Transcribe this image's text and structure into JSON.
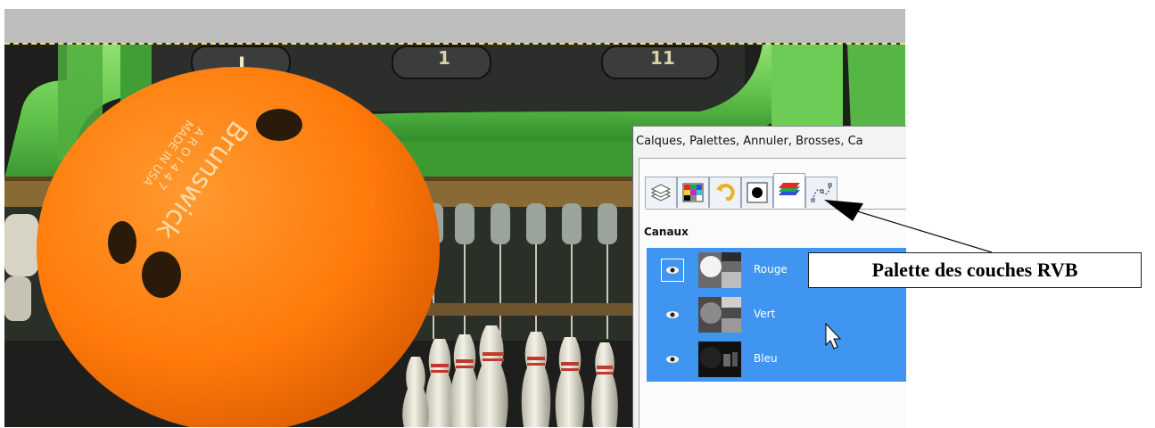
{
  "panel": {
    "title": "Calques, Palettes, Annuler, Brosses, Ca",
    "section_label": "Canaux",
    "tabs": [
      {
        "icon": "layers-icon"
      },
      {
        "icon": "palette-icon"
      },
      {
        "icon": "undo-history-icon"
      },
      {
        "icon": "brushes-icon"
      },
      {
        "icon": "channels-icon",
        "active": true
      },
      {
        "icon": "paths-icon"
      }
    ],
    "channels": [
      {
        "label": "Rouge",
        "visible": true
      },
      {
        "label": "Vert",
        "visible": true
      },
      {
        "label": "Bleu",
        "visible": true
      }
    ]
  },
  "callout": {
    "text": "Palette des couches RVB"
  },
  "photo": {
    "ball_text_brand": "Brunswick",
    "ball_text_made": "MADE IN USA",
    "ball_text_code": "A R O I 4 4 7",
    "slot_labels": [
      "I",
      "1",
      "11"
    ]
  },
  "colors": {
    "selection_blue": "#3f95f0",
    "ball_orange": "#ff7a0a",
    "rail_green": "#5fc24a"
  }
}
